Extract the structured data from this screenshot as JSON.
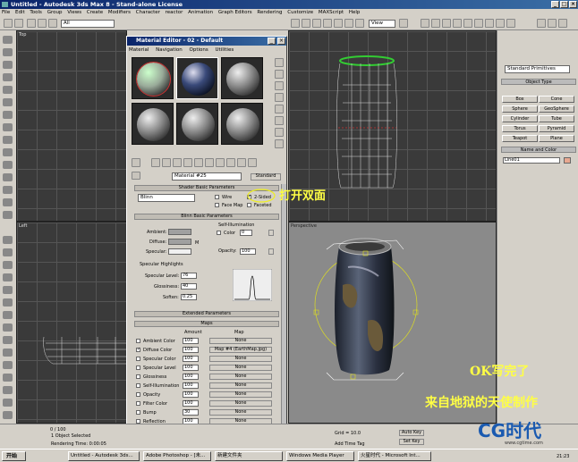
{
  "window": {
    "title": "Untitled - Autodesk 3ds Max 8 - Stand-alone License"
  },
  "menu": [
    "File",
    "Edit",
    "Tools",
    "Group",
    "Views",
    "Create",
    "Modifiers",
    "Character",
    "reactor",
    "Animation",
    "Graph Editors",
    "Rendering",
    "Customize",
    "MAXScript",
    "Help"
  ],
  "toolbar": {
    "selection_filter": "All",
    "ref_coord": "View"
  },
  "viewports": {
    "top": "Top",
    "left": "Left",
    "perspective": "Perspective"
  },
  "command_panel": {
    "category": "Standard Primitives",
    "object_type_header": "Object Type",
    "objects": [
      "Box",
      "Cone",
      "Sphere",
      "GeoSphere",
      "Cylinder",
      "Tube",
      "Torus",
      "Pyramid",
      "Teapot",
      "Plane"
    ],
    "name_color_header": "Name and Color",
    "object_name": "Line01",
    "object_color": "#e8a890"
  },
  "material_editor": {
    "title": "Material Editor - 02 - Default",
    "menu": [
      "Material",
      "Navigation",
      "Options",
      "Utilities"
    ],
    "material_name": "Material #25",
    "material_type": "Standard",
    "shader_header": "Shader Basic Parameters",
    "shader": "Blinn",
    "wire": "Wire",
    "two_sided": "2-Sided",
    "face_map": "Face Map",
    "faceted": "Faceted",
    "blinn_header": "Blinn Basic Parameters",
    "self_illum": "Self-Illumination",
    "color_label": "Color",
    "color_value": "0",
    "ambient": "Ambient:",
    "diffuse": "Diffuse:",
    "specular": "Specular:",
    "m_label": "M",
    "opacity_label": "Opacity:",
    "opacity_value": "100",
    "spec_highlights": "Specular Highlights",
    "spec_level_label": "Specular Level:",
    "spec_level": "76",
    "glossiness_label": "Glossiness:",
    "glossiness": "40",
    "soften_label": "Soften:",
    "soften": "0.25",
    "extended_header": "Extended Parameters",
    "maps_header": "Maps",
    "maps_col_amount": "Amount",
    "maps_col_map": "Map",
    "maps": [
      {
        "name": "Ambient Color",
        "amount": "100",
        "map": "None",
        "checked": false
      },
      {
        "name": "Diffuse Color",
        "amount": "100",
        "map": "Map #4 (EarthMap.jpg)",
        "checked": true
      },
      {
        "name": "Specular Color",
        "amount": "100",
        "map": "None",
        "checked": false
      },
      {
        "name": "Specular Level",
        "amount": "100",
        "map": "None",
        "checked": false
      },
      {
        "name": "Glossiness",
        "amount": "100",
        "map": "None",
        "checked": false
      },
      {
        "name": "Self-Illumination",
        "amount": "100",
        "map": "None",
        "checked": false
      },
      {
        "name": "Opacity",
        "amount": "100",
        "map": "None",
        "checked": false
      },
      {
        "name": "Filter Color",
        "amount": "100",
        "map": "None",
        "checked": false
      },
      {
        "name": "Bump",
        "amount": "30",
        "map": "None",
        "checked": false
      },
      {
        "name": "Reflection",
        "amount": "100",
        "map": "None",
        "checked": false
      }
    ]
  },
  "annotations": {
    "open_two_sided": "打开双面",
    "ok_done": "OK写完了",
    "credit": "来自地狱的天使制作",
    "logo": "CG时代",
    "logo_url": "www.cgtime.com"
  },
  "timebar": {
    "frame": "0 / 100",
    "selection": "1 Object Selected",
    "render_time": "Rendering Time: 0:00:05",
    "grid": "Grid = 10.0",
    "auto_key": "Auto Key",
    "set_key": "Set Key",
    "add_time_tag": "Add Time Tag"
  },
  "taskbar": {
    "start": "开始",
    "tasks": [
      "Untitled - Autodesk 3ds...",
      "Adobe Photoshop - [未...",
      "新建文件夹",
      "Windows Media Player",
      "火星时代 - Microsoft Int..."
    ],
    "clock": "21:23"
  }
}
